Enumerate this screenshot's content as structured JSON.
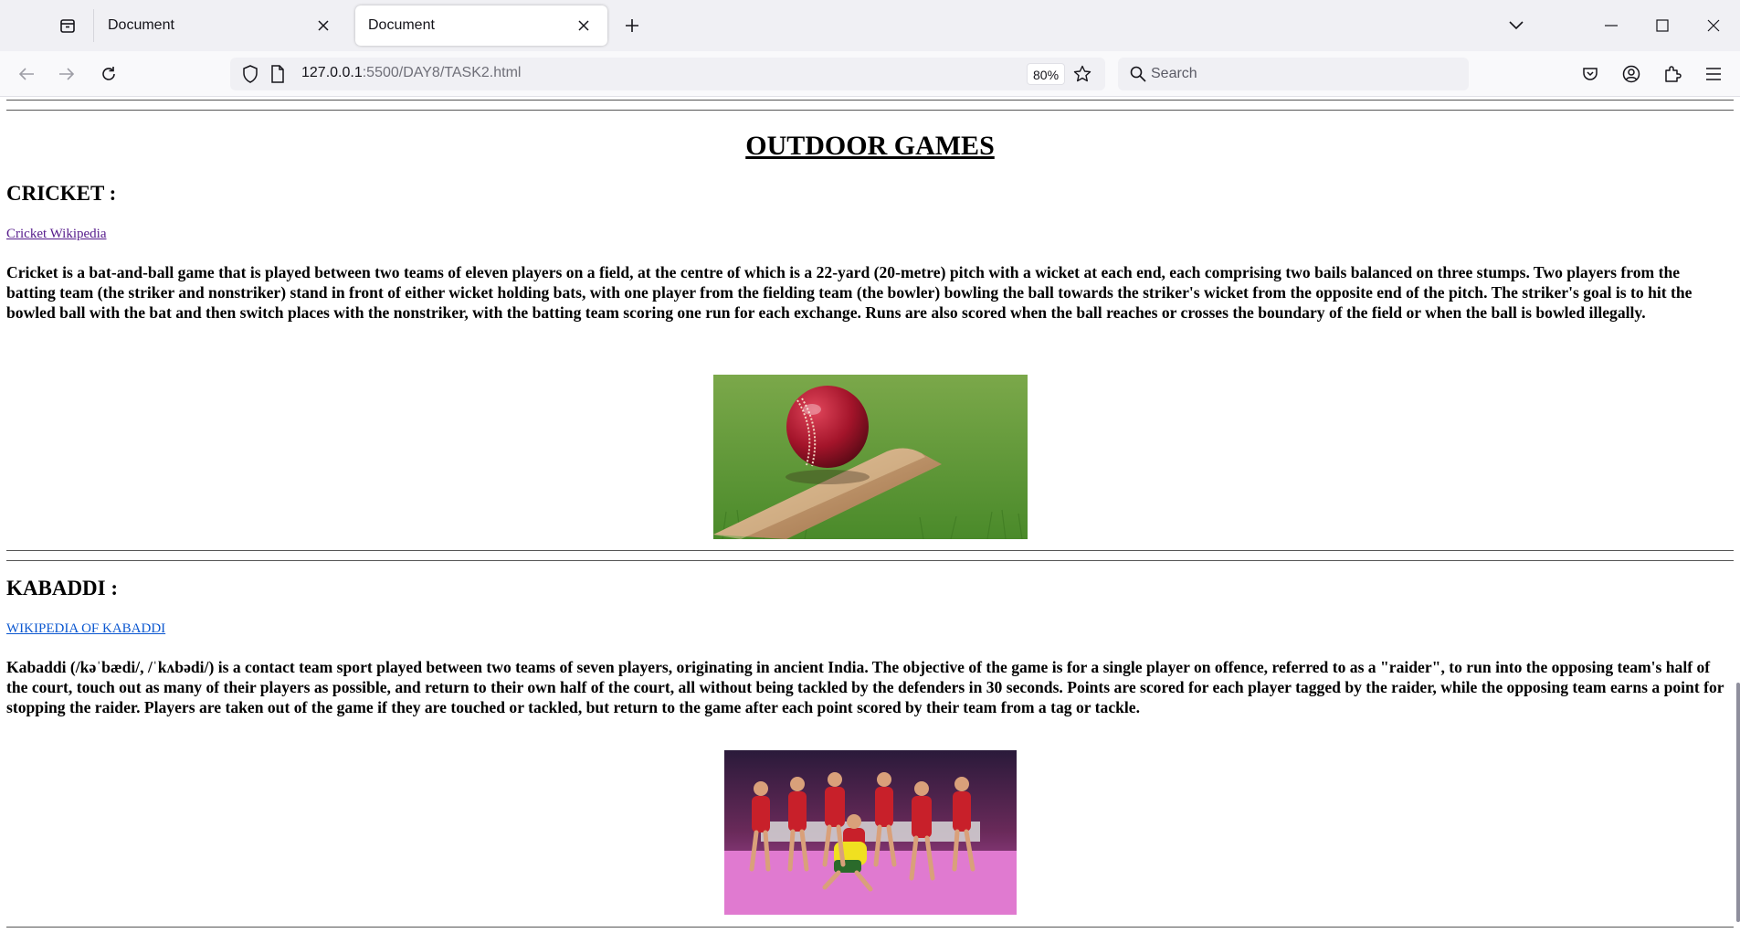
{
  "browser": {
    "tabs": [
      {
        "title": "Document",
        "active": false
      },
      {
        "title": "Document",
        "active": true
      }
    ],
    "url": {
      "host": "127.0.0.1",
      "path": ":5500/DAY8/TASK2.html"
    },
    "zoom": "80%",
    "search": {
      "placeholder": "Search"
    }
  },
  "page": {
    "title": "OUTDOOR GAMES",
    "sections": [
      {
        "heading": "CRICKET :",
        "link": "Cricket Wikipedia",
        "text": "Cricket is a bat-and-ball game that is played between two teams of eleven players on a field, at the centre of which is a 22-yard (20-metre) pitch with a wicket at each end, each comprising two bails balanced on three stumps. Two players from the batting team (the striker and nonstriker) stand in front of either wicket holding bats, with one player from the fielding team (the bowler) bowling the ball towards the striker's wicket from the opposite end of the pitch. The striker's goal is to hit the bowled ball with the bat and then switch places with the nonstriker, with the batting team scoring one run for each exchange. Runs are also scored when the ball reaches or crosses the boundary of the field or when the ball is bowled illegally."
      },
      {
        "heading": "KABADDI :",
        "link": "WIKIPEDIA OF KABADDI",
        "text": "Kabaddi (/kəˈbædi/, /ˈkʌbədi/) is a contact team sport played between two teams of seven players, originating in ancient India. The objective of the game is for a single player on offence, referred to as a \"raider\", to run into the opposing team's half of the court, touch out as many of their players as possible, and return to their own half of the court, all without being tackled by the defenders in 30 seconds. Points are scored for each player tagged by the raider, while the opposing team earns a point for stopping the raider. Players are taken out of the game if they are touched or tackled, but return to the game after each point scored by their team from a tag or tackle."
      }
    ]
  },
  "colors": {
    "link_visited": "#551a8b",
    "link_unvisited": "#0b57d0",
    "tabbar_bg": "#f0f0f4"
  }
}
